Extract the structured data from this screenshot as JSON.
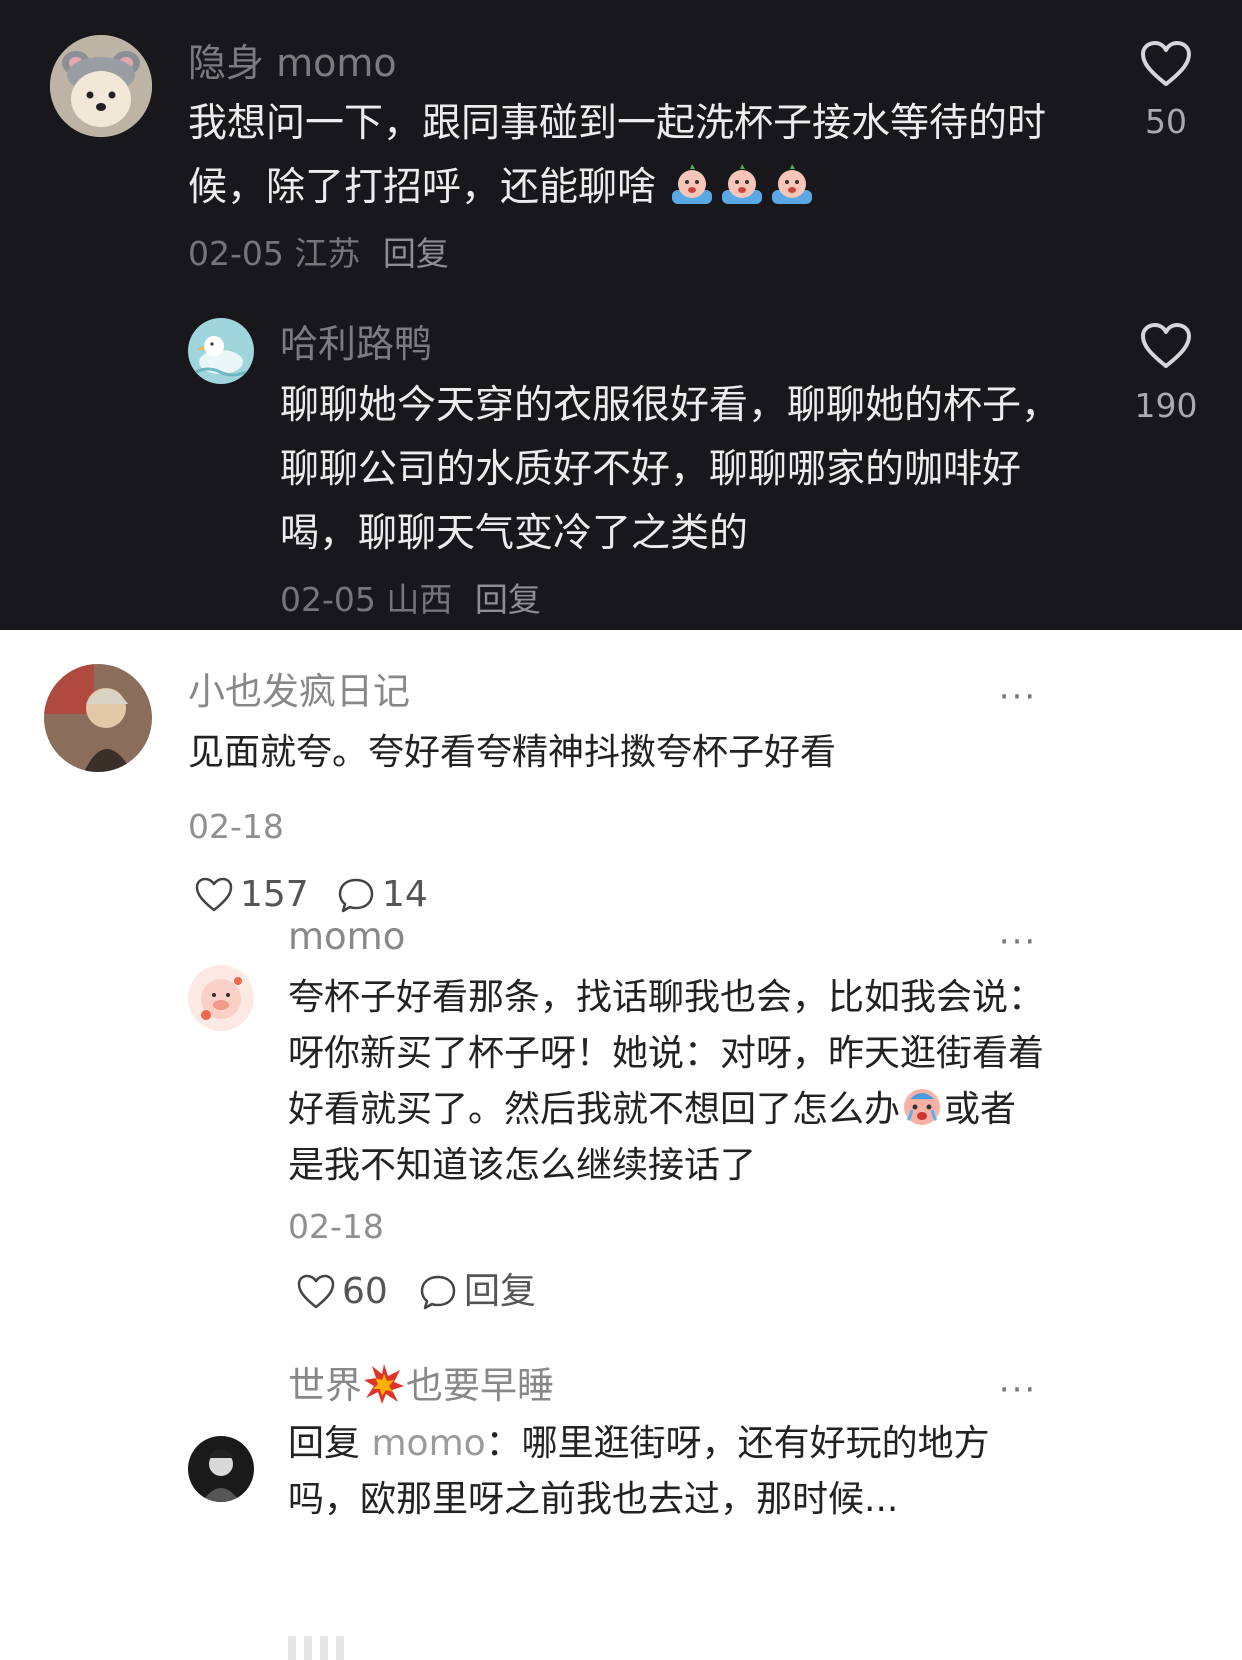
{
  "comments": [
    {
      "user": "隐身 momo",
      "text": "我想问一下，跟同事碰到一起洗杯子接水等待的时候，除了打招呼，还能聊啥",
      "emoji": "crying-emoji",
      "date": "02-05",
      "location": "江苏",
      "reply_label": "回复",
      "likes": "50",
      "reply": {
        "user": "哈利路鸭",
        "text": "聊聊她今天穿的衣服很好看，聊聊她的杯子，聊聊公司的水质好不好，聊聊哪家的咖啡好喝，聊聊天气变冷了之类的",
        "date": "02-05",
        "location": "山西",
        "reply_label": "回复",
        "likes": "190"
      }
    }
  ],
  "thread": {
    "user": "小也发疯日记",
    "text": "见面就夸。夸好看夸精神抖擞夸杯子好看",
    "date": "02-18",
    "likes": "157",
    "comments": "14",
    "more": "···",
    "replies": [
      {
        "user": "momo",
        "text_before": "夸杯子好看那条，找话聊我也会，比如我会说：呀你新买了杯子呀！她说：对呀，昨天逛街看着好看就买了。然后我就不想回了怎么办",
        "text_after": "或者是我不知道该怎么继续接话了",
        "emoji": "crying-emoji",
        "date": "02-18",
        "likes": "60",
        "reply_label": "回复",
        "more": "···"
      },
      {
        "user_before": "世界",
        "user_emoji": "collision-emoji",
        "user_after": "也要早睡",
        "reply_prefix": "回复",
        "mention": "momo",
        "colon": "：",
        "text": "哪里逛街呀，还有好玩的地方吗，欧那里呀之前我也去过，那时候...",
        "more": "···"
      }
    ]
  }
}
